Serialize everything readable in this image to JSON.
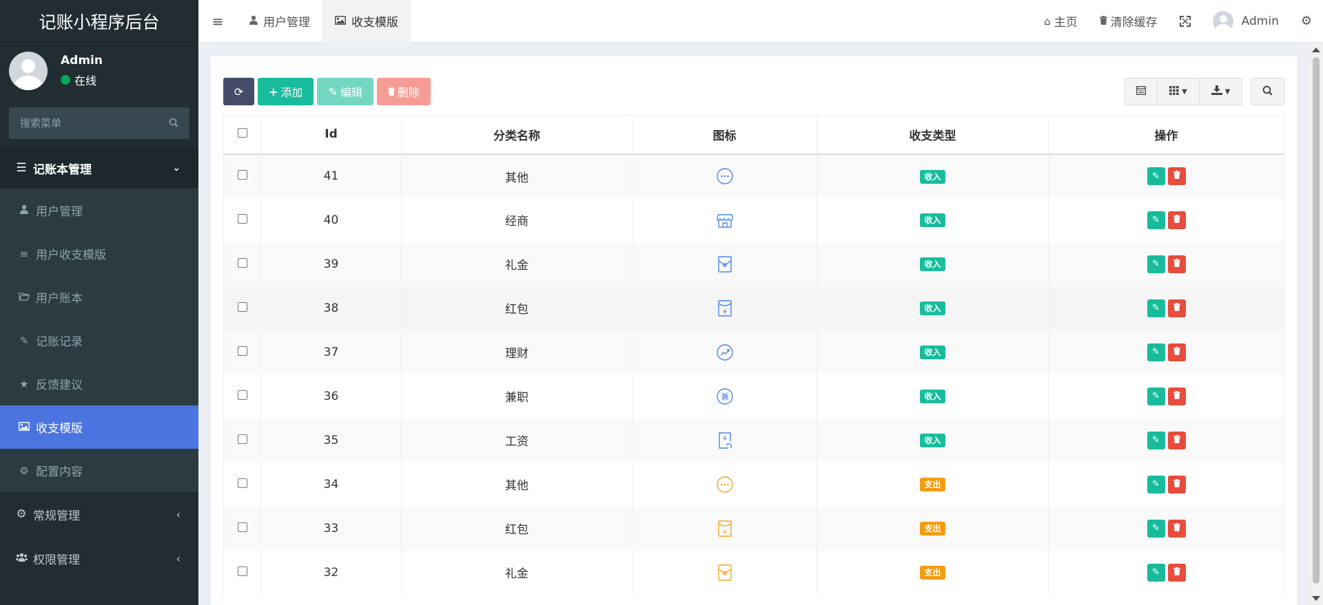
{
  "app": {
    "title": "记账小程序后台"
  },
  "user": {
    "name": "Admin",
    "status": "在线"
  },
  "sidebar": {
    "search_placeholder": "搜索菜单",
    "group": "记账本管理",
    "items": [
      {
        "label": "用户管理",
        "icon": "user-icon"
      },
      {
        "label": "用户收支模版",
        "icon": "list-icon"
      },
      {
        "label": "用户账本",
        "icon": "folder-open-icon"
      },
      {
        "label": "记账记录",
        "icon": "pencil-icon"
      },
      {
        "label": "反馈建议",
        "icon": "star-icon"
      },
      {
        "label": "收支模版",
        "icon": "image-icon",
        "active": true
      },
      {
        "label": "配置内容",
        "icon": "gear-icon"
      }
    ],
    "groups_collapsed": [
      {
        "label": "常规管理",
        "icon": "gears-icon"
      },
      {
        "label": "权限管理",
        "icon": "users-icon"
      }
    ]
  },
  "header": {
    "tabs": [
      {
        "label": "用户管理",
        "icon": "user-icon"
      },
      {
        "label": "收支模版",
        "icon": "image-icon",
        "active": true
      }
    ],
    "home": "主页",
    "clear_cache": "清除缓存",
    "admin": "Admin"
  },
  "toolbar": {
    "add": "添加",
    "edit": "编辑",
    "delete": "删除"
  },
  "table": {
    "columns": [
      "Id",
      "分类名称",
      "图标",
      "收支类型",
      "操作"
    ],
    "rows": [
      {
        "id": "41",
        "name": "其他",
        "icon": "more-circle",
        "type": "收入",
        "kind": "in"
      },
      {
        "id": "40",
        "name": "经商",
        "icon": "shop",
        "type": "收入",
        "kind": "in"
      },
      {
        "id": "39",
        "name": "礼金",
        "icon": "envelope",
        "type": "收入",
        "kind": "in"
      },
      {
        "id": "38",
        "name": "红包",
        "icon": "red-packet",
        "type": "收入",
        "kind": "in"
      },
      {
        "id": "37",
        "name": "理财",
        "icon": "trend-circle",
        "type": "收入",
        "kind": "in"
      },
      {
        "id": "36",
        "name": "兼职",
        "icon": "jian-circle",
        "type": "收入",
        "kind": "in"
      },
      {
        "id": "35",
        "name": "工资",
        "icon": "salary",
        "type": "收入",
        "kind": "in"
      },
      {
        "id": "34",
        "name": "其他",
        "icon": "more-circle",
        "type": "支出",
        "kind": "out"
      },
      {
        "id": "33",
        "name": "红包",
        "icon": "red-packet",
        "type": "支出",
        "kind": "out"
      },
      {
        "id": "32",
        "name": "礼金",
        "icon": "envelope",
        "type": "支出",
        "kind": "out"
      }
    ]
  },
  "colors": {
    "income": "#18bc9c",
    "expense": "#f39c12",
    "icon_in": "#4a86e8",
    "icon_out": "#f5a623"
  }
}
